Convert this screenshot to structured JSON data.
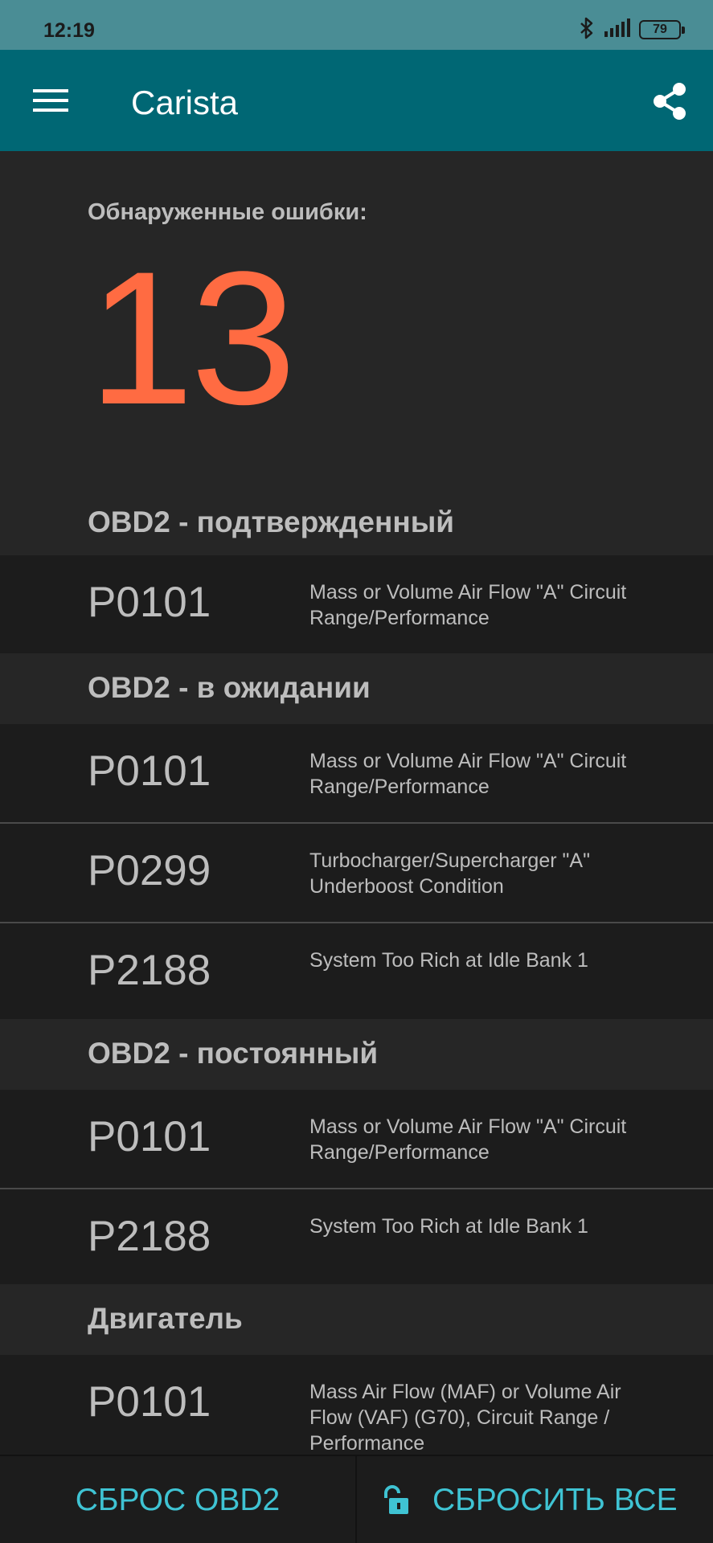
{
  "status_bar": {
    "time": "12:19",
    "battery": "79"
  },
  "app_bar": {
    "title": "Carista",
    "menu_icon": "hamburger-menu-icon",
    "share_icon": "share-icon"
  },
  "summary": {
    "label": "Обнаруженные ошибки:",
    "count": "13",
    "count_color": "#ff6b42"
  },
  "sections": [
    {
      "title": "OBD2 - подтвержденный",
      "items": [
        {
          "code": "P0101",
          "description": "Mass or Volume Air Flow \"A\" Circuit Range/Performance"
        }
      ]
    },
    {
      "title": "OBD2 - в ожидании",
      "items": [
        {
          "code": "P0101",
          "description": "Mass or Volume Air Flow \"A\" Circuit Range/Performance"
        },
        {
          "code": "P0299",
          "description": "Turbocharger/Supercharger \"A\" Underboost Condition"
        },
        {
          "code": "P2188",
          "description": "System Too Rich at Idle Bank 1"
        }
      ]
    },
    {
      "title": "OBD2 - постоянный",
      "items": [
        {
          "code": "P0101",
          "description": "Mass or Volume Air Flow \"A\" Circuit Range/Performance"
        },
        {
          "code": "P2188",
          "description": "System Too Rich at Idle Bank 1"
        }
      ]
    },
    {
      "title": "Двигатель",
      "items": [
        {
          "code": "P0101",
          "description": "Mass Air Flow (MAF) or Volume Air Flow (VAF) (G70), Circuit Range / Performance"
        }
      ]
    }
  ],
  "bottom_bar": {
    "reset_obd2_label": "СБРОС OBD2",
    "reset_all_label": "СБРОСИТЬ ВСЕ",
    "reset_all_icon": "unlock-icon",
    "accent_color": "#3fc3d3"
  },
  "colors": {
    "app_bar": "#006774",
    "status_bar": "#4a8d95",
    "background": "#262626",
    "row_background": "#1c1c1c"
  }
}
